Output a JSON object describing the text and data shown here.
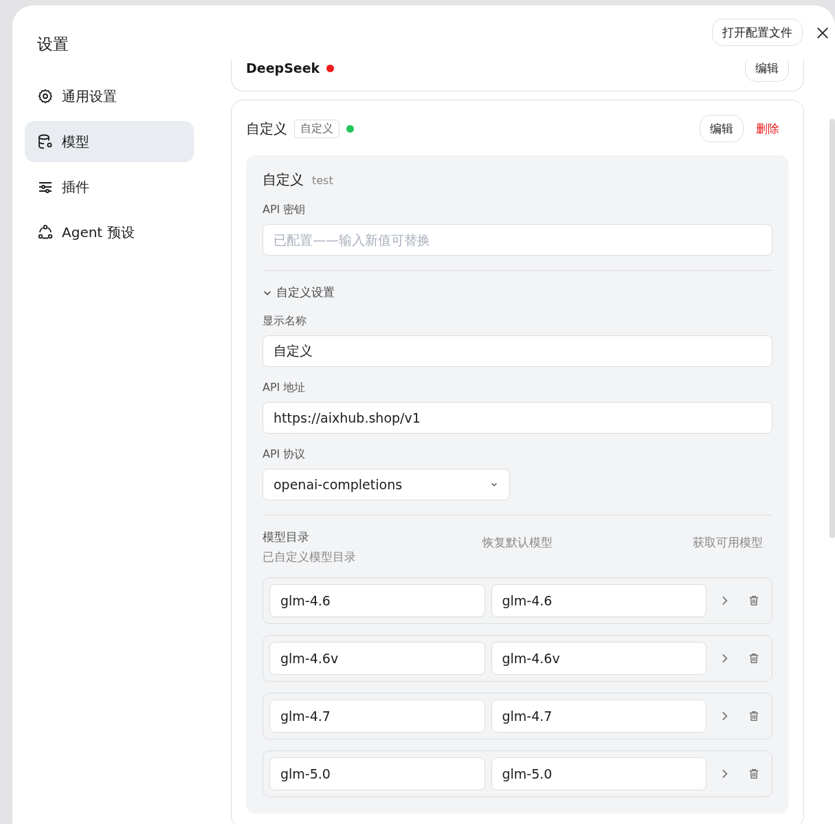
{
  "title": "设置",
  "open_config_button": "打开配置文件",
  "nav": [
    {
      "label": "通用设置",
      "selected": false
    },
    {
      "label": "模型",
      "selected": true
    },
    {
      "label": "插件",
      "selected": false
    },
    {
      "label": "Agent 预设",
      "selected": false
    }
  ],
  "providers": [
    {
      "name": "DeepSeek",
      "color": "#ee1c1c",
      "edit": "编辑"
    },
    {
      "name": "自定义",
      "tag": "自定义",
      "color": "#22c55e",
      "edit": "编辑",
      "delete": "删除",
      "detail": {
        "title": "自定义",
        "subtitle": "test",
        "api_key": {
          "label": "API 密钥",
          "placeholder": "已配置——输入新值可替换"
        },
        "custom_settings": {
          "label": "自定义设置",
          "expanded": true
        },
        "display_name": {
          "label": "显示名称",
          "value": "自定义"
        },
        "api_url": {
          "label": "API 地址",
          "value": "https://aixhub.shop/v1"
        },
        "protocol": {
          "label": "API 协议",
          "value": "openai-completions"
        },
        "catalog": {
          "title": "模型目录",
          "subtitle": "已自定义模型目录",
          "restore": "恢复默认模型",
          "fetch": "获取可用模型",
          "models": [
            {
              "id": "glm-4.6",
              "name": "glm-4.6"
            },
            {
              "id": "glm-4.6v",
              "name": "glm-4.6v"
            },
            {
              "id": "glm-4.7",
              "name": "glm-4.7"
            },
            {
              "id": "glm-5.0",
              "name": "glm-5.0"
            }
          ]
        }
      }
    }
  ]
}
